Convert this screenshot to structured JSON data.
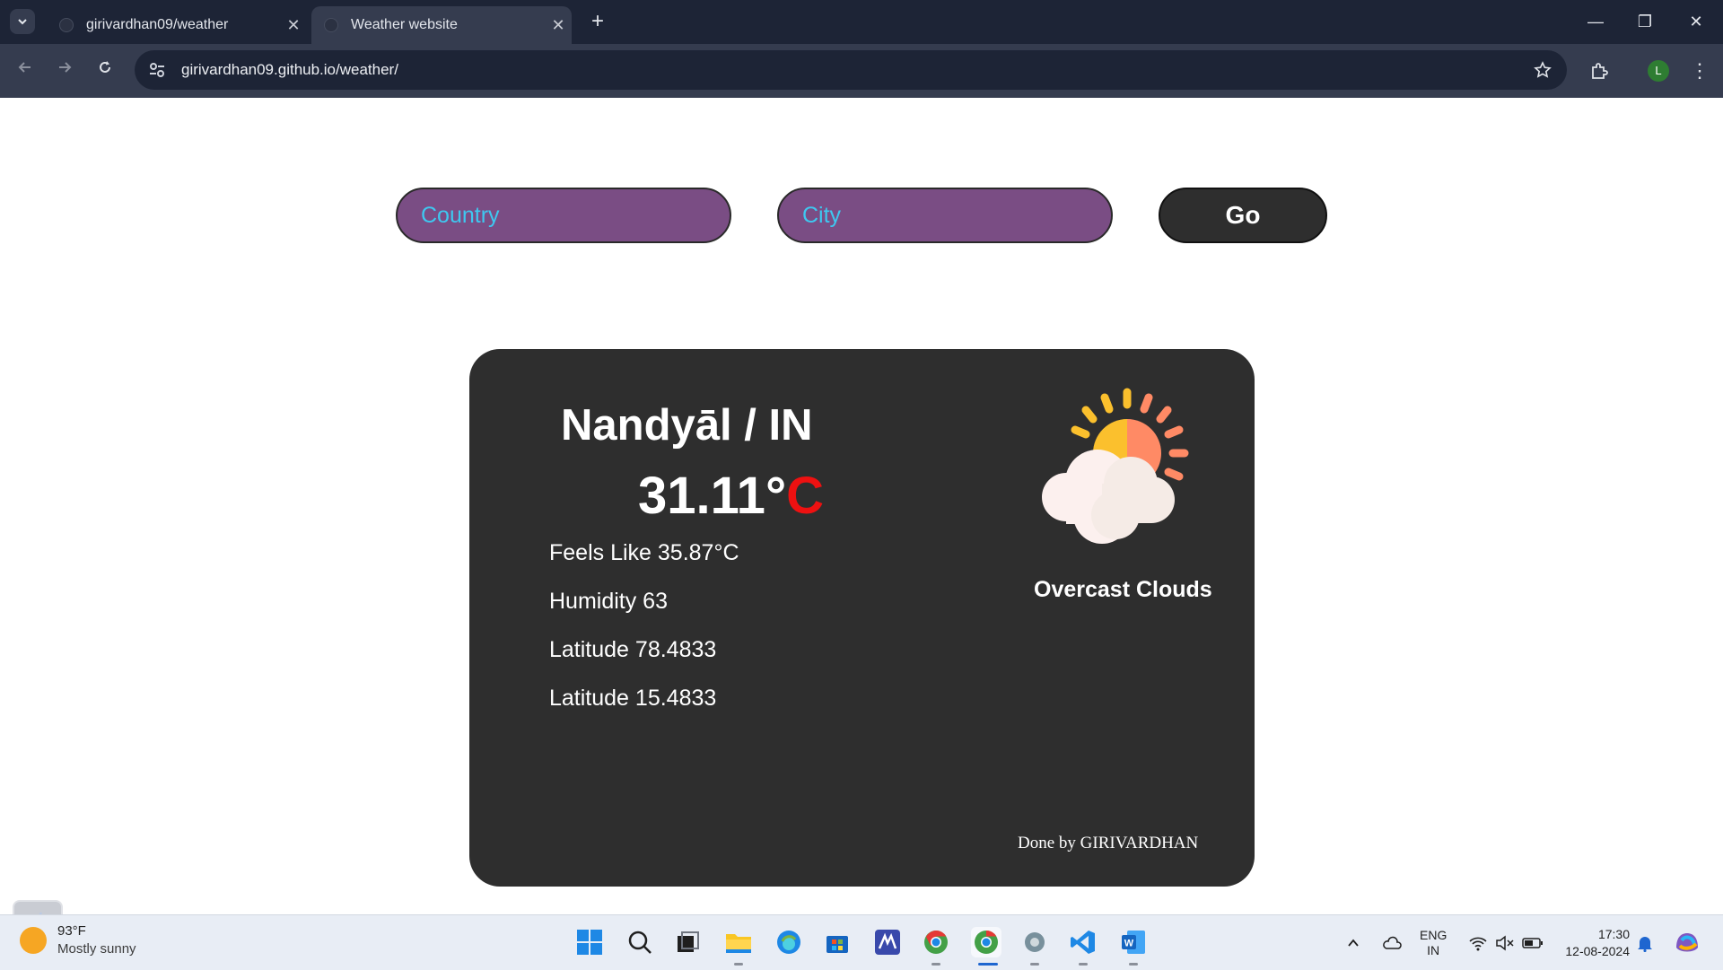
{
  "browser": {
    "tabs": [
      {
        "title": "girivardhan09/weather",
        "active": false
      },
      {
        "title": "Weather website",
        "active": true
      }
    ],
    "url": "girivardhan09.github.io/weather/",
    "profile_initial": "L"
  },
  "search": {
    "country_placeholder": "Country",
    "city_placeholder": "City",
    "go_label": "Go"
  },
  "weather": {
    "location": "Nandyāl / IN",
    "temp_value": "31.11°",
    "temp_unit": "C",
    "feels_like": "Feels Like 35.87°C",
    "humidity": "Humidity 63",
    "latitude_1": "Latitude 78.4833",
    "latitude_2": "Latitude 15.4833",
    "condition": "Overcast Clouds",
    "credit": "Done by GIRIVARDHAN"
  },
  "taskbar": {
    "weather_temp": "93°F",
    "weather_text": "Mostly sunny",
    "lang_1": "ENG",
    "lang_2": "IN",
    "time": "17:30",
    "date": "12-08-2024"
  },
  "colors": {
    "input_bg": "#7a4d84",
    "placeholder": "#3ec8f0",
    "card_bg": "#2e2e2e",
    "temp_unit": "#ee1111"
  }
}
